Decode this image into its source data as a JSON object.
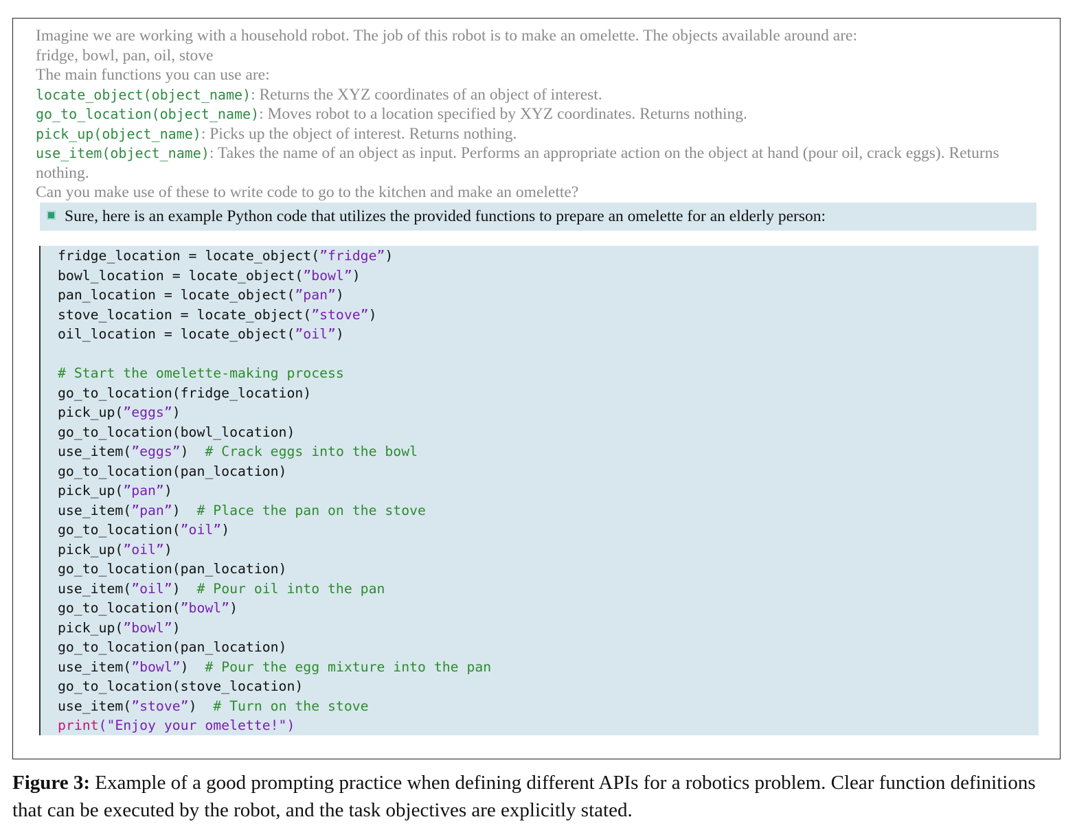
{
  "prompt": {
    "intro_line1": "Imagine we are working with a household robot. The job of this robot is to make an omelette. The objects available around are:",
    "intro_line2": "fridge, bowl, pan, oil, stove",
    "functions_heading": "The main functions you can use are:",
    "functions": [
      {
        "signature": "locate_object(object_name)",
        "description": ": Returns the XYZ coordinates of an object of interest."
      },
      {
        "signature": "go_to_location(object_name)",
        "description": ": Moves robot to a location specified by XYZ coordinates. Returns nothing."
      },
      {
        "signature": "pick_up(object_name)",
        "description": ": Picks up the object of interest. Returns nothing."
      },
      {
        "signature": "use_item(object_name)",
        "description": ": Takes the name of an object as input. Performs an appropriate action on the object at hand (pour oil, crack eggs). Returns nothing."
      }
    ],
    "question": "Can you make use of these to write code to go to the kitchen and make an omelette?"
  },
  "answer": {
    "text": "Sure, here is an example Python code that utilizes the provided functions to prepare an omelette for an elderly person:"
  },
  "code_lines": [
    [
      {
        "t": "fridge_location = locate_object("
      },
      {
        "t": "”fridge”",
        "c": "str"
      },
      {
        "t": ")"
      }
    ],
    [
      {
        "t": "bowl_location = locate_object("
      },
      {
        "t": "”bowl”",
        "c": "str"
      },
      {
        "t": ")"
      }
    ],
    [
      {
        "t": "pan_location = locate_object("
      },
      {
        "t": "”pan”",
        "c": "str"
      },
      {
        "t": ")"
      }
    ],
    [
      {
        "t": "stove_location = locate_object("
      },
      {
        "t": "”stove”",
        "c": "str"
      },
      {
        "t": ")"
      }
    ],
    [
      {
        "t": "oil_location = locate_object("
      },
      {
        "t": "”oil”",
        "c": "str"
      },
      {
        "t": ")"
      }
    ],
    [],
    [
      {
        "t": "# Start the omelette-making process",
        "c": "cmt"
      }
    ],
    [
      {
        "t": "go_to_location(fridge_location)"
      }
    ],
    [
      {
        "t": "pick_up("
      },
      {
        "t": "”eggs”",
        "c": "str"
      },
      {
        "t": ")"
      }
    ],
    [
      {
        "t": "go_to_location(bowl_location)"
      }
    ],
    [
      {
        "t": "use_item("
      },
      {
        "t": "”eggs”",
        "c": "str"
      },
      {
        "t": ")  "
      },
      {
        "t": "# Crack eggs into the bowl",
        "c": "cmt"
      }
    ],
    [
      {
        "t": "go_to_location(pan_location)"
      }
    ],
    [
      {
        "t": "pick_up("
      },
      {
        "t": "”pan”",
        "c": "str"
      },
      {
        "t": ")"
      }
    ],
    [
      {
        "t": "use_item("
      },
      {
        "t": "”pan”",
        "c": "str"
      },
      {
        "t": ")  "
      },
      {
        "t": "# Place the pan on the stove",
        "c": "cmt"
      }
    ],
    [
      {
        "t": "go_to_location("
      },
      {
        "t": "”oil”",
        "c": "str"
      },
      {
        "t": ")"
      }
    ],
    [
      {
        "t": "pick_up("
      },
      {
        "t": "”oil”",
        "c": "str"
      },
      {
        "t": ")"
      }
    ],
    [
      {
        "t": "go_to_location(pan_location)"
      }
    ],
    [
      {
        "t": "use_item("
      },
      {
        "t": "”oil”",
        "c": "str"
      },
      {
        "t": ")  "
      },
      {
        "t": "# Pour oil into the pan",
        "c": "cmt"
      }
    ],
    [
      {
        "t": "go_to_location("
      },
      {
        "t": "”bowl”",
        "c": "str"
      },
      {
        "t": ")"
      }
    ],
    [
      {
        "t": "pick_up("
      },
      {
        "t": "”bowl”",
        "c": "str"
      },
      {
        "t": ")"
      }
    ],
    [
      {
        "t": "go_to_location(pan_location)"
      }
    ],
    [
      {
        "t": "use_item("
      },
      {
        "t": "”bowl”",
        "c": "str"
      },
      {
        "t": ")  "
      },
      {
        "t": "# Pour the egg mixture into the pan",
        "c": "cmt"
      }
    ],
    [
      {
        "t": "go_to_location(stove_location)"
      }
    ],
    [
      {
        "t": "use_item("
      },
      {
        "t": "”stove”",
        "c": "str"
      },
      {
        "t": ")  "
      },
      {
        "t": "# Turn on the stove",
        "c": "cmt"
      }
    ],
    [
      {
        "t": "print",
        "c": "kw"
      },
      {
        "t": "(\"Enjoy your omelette!\")",
        "c": "str"
      }
    ]
  ],
  "caption": {
    "label": "Figure 3:",
    "text": " Example of a good prompting practice when defining different APIs for a robotics problem. Clear function definitions that can be executed by the robot, and the task objectives are explicitly stated."
  },
  "colors": {
    "code_background": "#d8e7ee",
    "function_name": "#2e8b43",
    "prompt_text": "#8b8b8b",
    "string": "#7a1fb0",
    "comment": "#2e8b2e",
    "keyword": "#c4187a"
  },
  "icons": {
    "assistant": "chatgpt-logo-icon"
  }
}
